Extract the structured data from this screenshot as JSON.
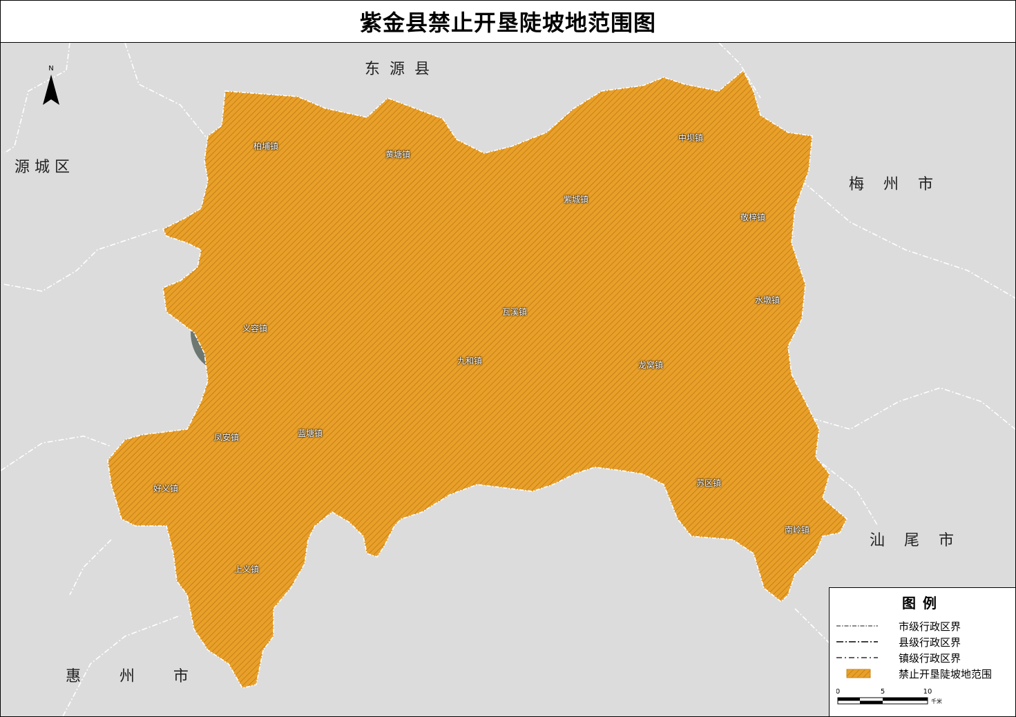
{
  "title": "紫金县禁止开垦陡坡地范围图",
  "neighbors": {
    "north": "东  源  县",
    "west": "源 城 区",
    "east": "梅    州    市",
    "southeast": "汕    尾    市",
    "southwest": "惠        州        市"
  },
  "north_arrow": {
    "letter": "N"
  },
  "towns": [
    {
      "name": "柏埔镇"
    },
    {
      "name": "黄塘镇"
    },
    {
      "name": "中坝镇"
    },
    {
      "name": "紫城镇"
    },
    {
      "name": "敬梓镇"
    },
    {
      "name": "水墩镇"
    },
    {
      "name": "义容镇"
    },
    {
      "name": "瓦溪镇"
    },
    {
      "name": "九和镇"
    },
    {
      "name": "龙窝镇"
    },
    {
      "name": "凤安镇"
    },
    {
      "name": "蓝塘镇"
    },
    {
      "name": "好义镇"
    },
    {
      "name": "苏区镇"
    },
    {
      "name": "南岭镇"
    },
    {
      "name": "上义镇"
    }
  ],
  "legend": {
    "title": "图例",
    "items": [
      {
        "label": "市级行政区界",
        "symbol": "city-boundary"
      },
      {
        "label": "县级行政区界",
        "symbol": "county-boundary"
      },
      {
        "label": "镇级行政区界",
        "symbol": "town-boundary"
      },
      {
        "label": "禁止开垦陡坡地范围",
        "symbol": "hatch-fill"
      }
    ],
    "scale": {
      "ticks": [
        "0",
        "5",
        "10"
      ],
      "unit": "千米"
    }
  },
  "colors": {
    "background": "#dcdcdc",
    "county_fill": "#e89a1c",
    "hatch": "#c97f10",
    "imagery_dark": "#4e5a52",
    "boundary": "#ffffff"
  }
}
